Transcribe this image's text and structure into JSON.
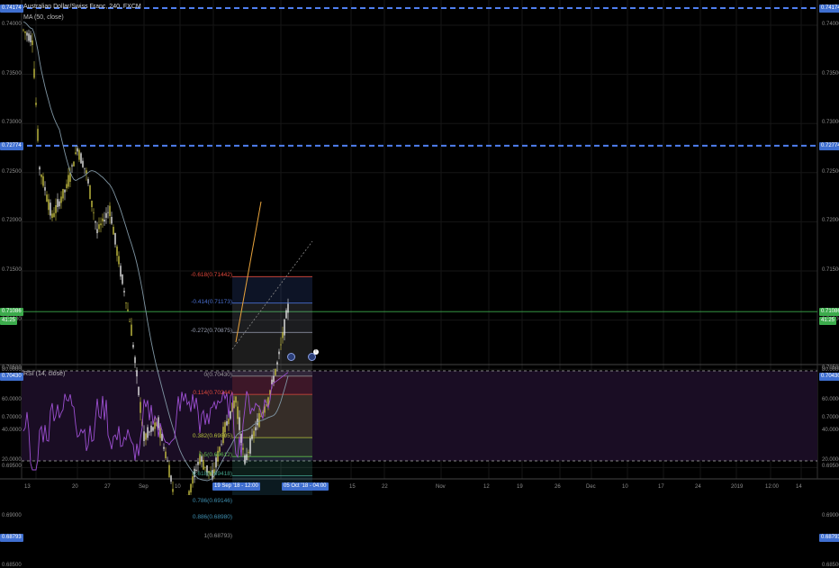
{
  "header": {
    "symbol_title": "Australian Dollar/Swiss Franc, 240, FXCM",
    "ma_label": "MA (50, close)",
    "rsi_label": "RSI (14, close)"
  },
  "price_axis": {
    "ticks": [
      "0.74000",
      "0.73500",
      "0.73000",
      "0.72500",
      "0.72000",
      "0.71500",
      "0.71000",
      "0.70500",
      "0.70000",
      "0.69500",
      "0.69000",
      "0.68500"
    ],
    "right_tags": [
      "0.74174",
      "0.72774",
      "0.71086",
      "41:25",
      "0.70430",
      "0.68793"
    ],
    "left_tags": [
      "0.74174",
      "0.72774",
      "0.71086",
      "41:25",
      "0.70430",
      "0.68793"
    ]
  },
  "rsi_axis": {
    "ticks": [
      "80.0000",
      "60.0000",
      "40.0000",
      "20.0000"
    ]
  },
  "time_axis": {
    "labels": [
      "13",
      "20",
      "27",
      "Sep",
      "10",
      "15",
      "22",
      "Nov",
      "12",
      "19",
      "26",
      "Dec",
      "10",
      "17",
      "24",
      "2019",
      "12:00",
      "14"
    ],
    "cursor_tags": [
      "19 Sep '18 - 12:00",
      "05 Oct '18 - 04:00"
    ]
  },
  "fibonacci": {
    "levels": [
      {
        "label": "-0.618(0.71442)",
        "value": 0.71442,
        "color": "#e0483c"
      },
      {
        "label": "-0.414(0.71173)",
        "value": 0.71173,
        "color": "#4a6fd1"
      },
      {
        "label": "-0.272(0.70875)",
        "value": 0.70875,
        "color": "#9aa0b4"
      },
      {
        "label": "0(0.70430)",
        "value": 0.7043,
        "color": "#9a9a9a"
      },
      {
        "label": "0.114(0.70244)",
        "value": 0.70244,
        "color": "#e0483c"
      },
      {
        "label": "0.382(0.69805)",
        "value": 0.69805,
        "color": "#b8c23c"
      },
      {
        "label": "0.5(0.69612)",
        "value": 0.69612,
        "color": "#5dbb4a"
      },
      {
        "label": "0.618(0.69418)",
        "value": 0.69418,
        "color": "#43a38b"
      },
      {
        "label": "0.786(0.69146)",
        "value": 0.69146,
        "color": "#3e8fb0"
      },
      {
        "label": "0.886(0.68980)",
        "value": 0.6898,
        "color": "#3e8fb0"
      },
      {
        "label": "1(0.68793)",
        "value": 0.68793,
        "color": "#8a8a8a"
      }
    ]
  },
  "colors": {
    "up_candle": "#c9c241",
    "down_candle": "#e8e8e8",
    "ma_line": "#7f95a3",
    "hline_dashed": "#4f7ff0",
    "current_price": "#3cab4c",
    "rsi_line": "#9c4fd1",
    "rsi_bg": "#1a0d24"
  },
  "events": [
    {
      "name": "calendar-event-1",
      "label": ""
    },
    {
      "name": "calendar-event-2",
      "label": "!"
    }
  ]
}
